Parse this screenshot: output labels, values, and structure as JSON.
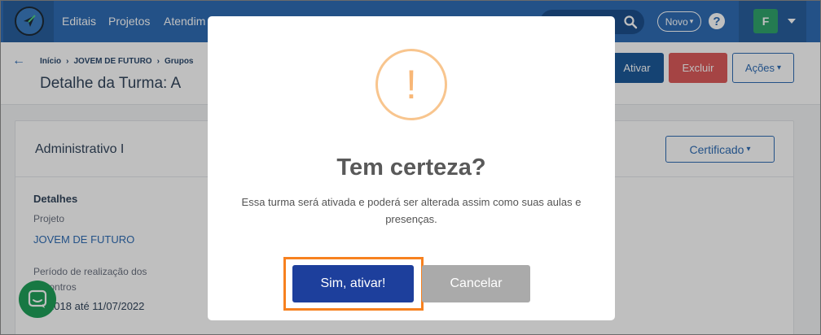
{
  "navbar": {
    "items": [
      "Editais",
      "Projetos",
      "Atendim"
    ],
    "novo_label": "Novo",
    "help_label": "?",
    "user_initial": "F"
  },
  "header": {
    "breadcrumb": [
      "Início",
      "JOVEM DE FUTURO",
      "Grupos"
    ],
    "title": "Detalhe da Turma: A",
    "ativar_label": "Ativar",
    "excluir_label": "Excluir",
    "acoes_label": "Ações"
  },
  "card": {
    "title": "Administrativo I",
    "certificado_label": "Certificado",
    "detalhes_label": "Detalhes",
    "projeto_label": "Projeto",
    "projeto_value": "JOVEM DE FUTURO",
    "periodo_label": "Período de realização dos encontros",
    "periodo_value": "08/2018 até 11/07/2022"
  },
  "modal": {
    "icon_glyph": "!",
    "title": "Tem certeza?",
    "text": "Essa turma será ativada e poderá ser alterada assim como suas aulas e presenças.",
    "confirm_label": "Sim, ativar!",
    "cancel_label": "Cancelar"
  },
  "colors": {
    "navbar": "#2f6db5",
    "confirm": "#1d3f9c",
    "cancel": "#aaaaaa",
    "highlight": "#f7811f",
    "warning": "#f8c58e"
  }
}
